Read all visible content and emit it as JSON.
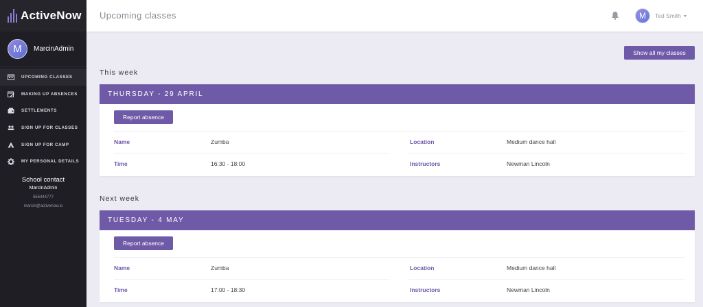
{
  "app": {
    "name": "ActiveNow",
    "accent": "#6f5aa8",
    "sidebar_bg": "#1e1e24"
  },
  "profile": {
    "initial": "M",
    "name": "MarcinAdmin"
  },
  "nav": [
    {
      "label": "UPCOMING CLASSES",
      "icon": "calendar-icon",
      "active": true
    },
    {
      "label": "MAKING UP ABSENCES",
      "icon": "calendar-edit-icon",
      "active": false
    },
    {
      "label": "SETTLEMENTS",
      "icon": "wallet-icon",
      "active": false
    },
    {
      "label": "SIGN UP FOR CLASSES",
      "icon": "users-icon",
      "active": false
    },
    {
      "label": "SIGN UP FOR CAMP",
      "icon": "tent-icon",
      "active": false
    },
    {
      "label": "MY PERSONAL DETAILS",
      "icon": "gear-icon",
      "active": false
    }
  ],
  "contact": {
    "title": "School contact",
    "name": "MarcinAdmin",
    "phone": "555444777",
    "email": "marcin@activenow.io"
  },
  "header": {
    "title": "Upcoming classes",
    "user_initial": "M",
    "user_name": "Ted Smith"
  },
  "show_all_label": "Show all my classes",
  "weeks": [
    {
      "title": "This week",
      "day": "THURSDAY - 29 APRIL",
      "report_label": "Report absence",
      "name_label": "Name",
      "name": "Zumba",
      "time_label": "Time",
      "time": "16:30 - 18:00",
      "location_label": "Location",
      "location": "Medium dance hall",
      "instructors_label": "Instructors",
      "instructors": "Newman Lincoln"
    },
    {
      "title": "Next week",
      "day": "TUESDAY - 4 MAY",
      "report_label": "Report absence",
      "name_label": "Name",
      "name": "Zumba",
      "time_label": "Time",
      "time": "17:00 - 18:30",
      "location_label": "Location",
      "location": "Medium dance hall",
      "instructors_label": "Instructors",
      "instructors": "Newman Lincoln"
    }
  ]
}
